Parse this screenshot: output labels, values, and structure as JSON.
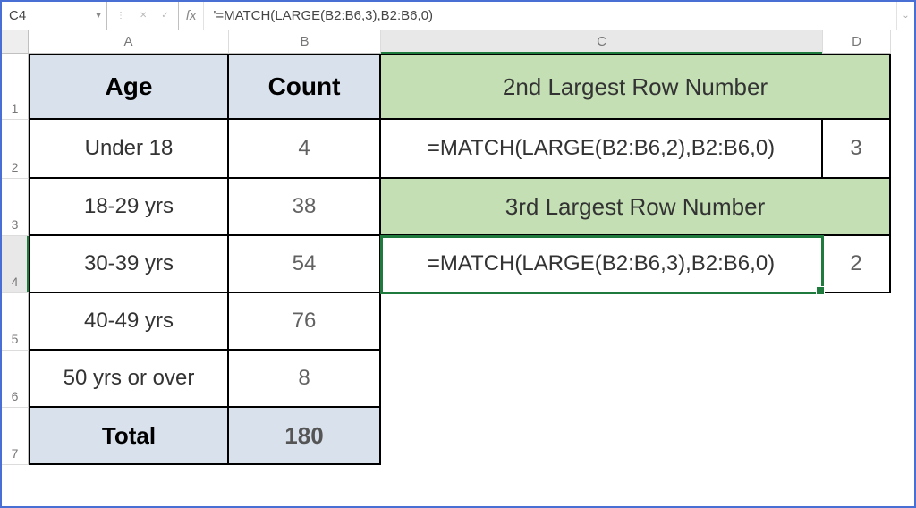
{
  "formula_bar": {
    "cell_ref": "C4",
    "fx_label": "fx",
    "formula": "'=MATCH(LARGE(B2:B6,3),B2:B6,0)"
  },
  "columns": [
    "A",
    "B",
    "C",
    "D"
  ],
  "row_numbers": [
    "1",
    "2",
    "3",
    "4",
    "5",
    "6",
    "7"
  ],
  "headers": {
    "age": "Age",
    "count": "Count",
    "second_largest": "2nd Largest Row Number",
    "third_largest": "3rd Largest Row Number"
  },
  "rows": [
    {
      "age": "Under 18",
      "count": "4"
    },
    {
      "age": "18-29 yrs",
      "count": "38"
    },
    {
      "age": "30-39 yrs",
      "count": "54"
    },
    {
      "age": "40-49 yrs",
      "count": "76"
    },
    {
      "age": "50 yrs or over",
      "count": "8"
    }
  ],
  "total": {
    "label": "Total",
    "value": "180"
  },
  "formulas": {
    "c2": "=MATCH(LARGE(B2:B6,2),B2:B6,0)",
    "c4": "=MATCH(LARGE(B2:B6,3),B2:B6,0)"
  },
  "results": {
    "d2": "3",
    "d4": "2"
  },
  "icons": {
    "dropdown": "▼",
    "dots": "⋮",
    "cancel": "✕",
    "confirm": "✓",
    "expand": "⌄"
  },
  "chart_data": {
    "type": "table",
    "title": "Age distribution counts",
    "columns": [
      "Age",
      "Count"
    ],
    "rows": [
      [
        "Under 18",
        4
      ],
      [
        "18-29 yrs",
        38
      ],
      [
        "30-39 yrs",
        54
      ],
      [
        "40-49 yrs",
        76
      ],
      [
        "50 yrs or over",
        8
      ]
    ],
    "total": 180
  }
}
